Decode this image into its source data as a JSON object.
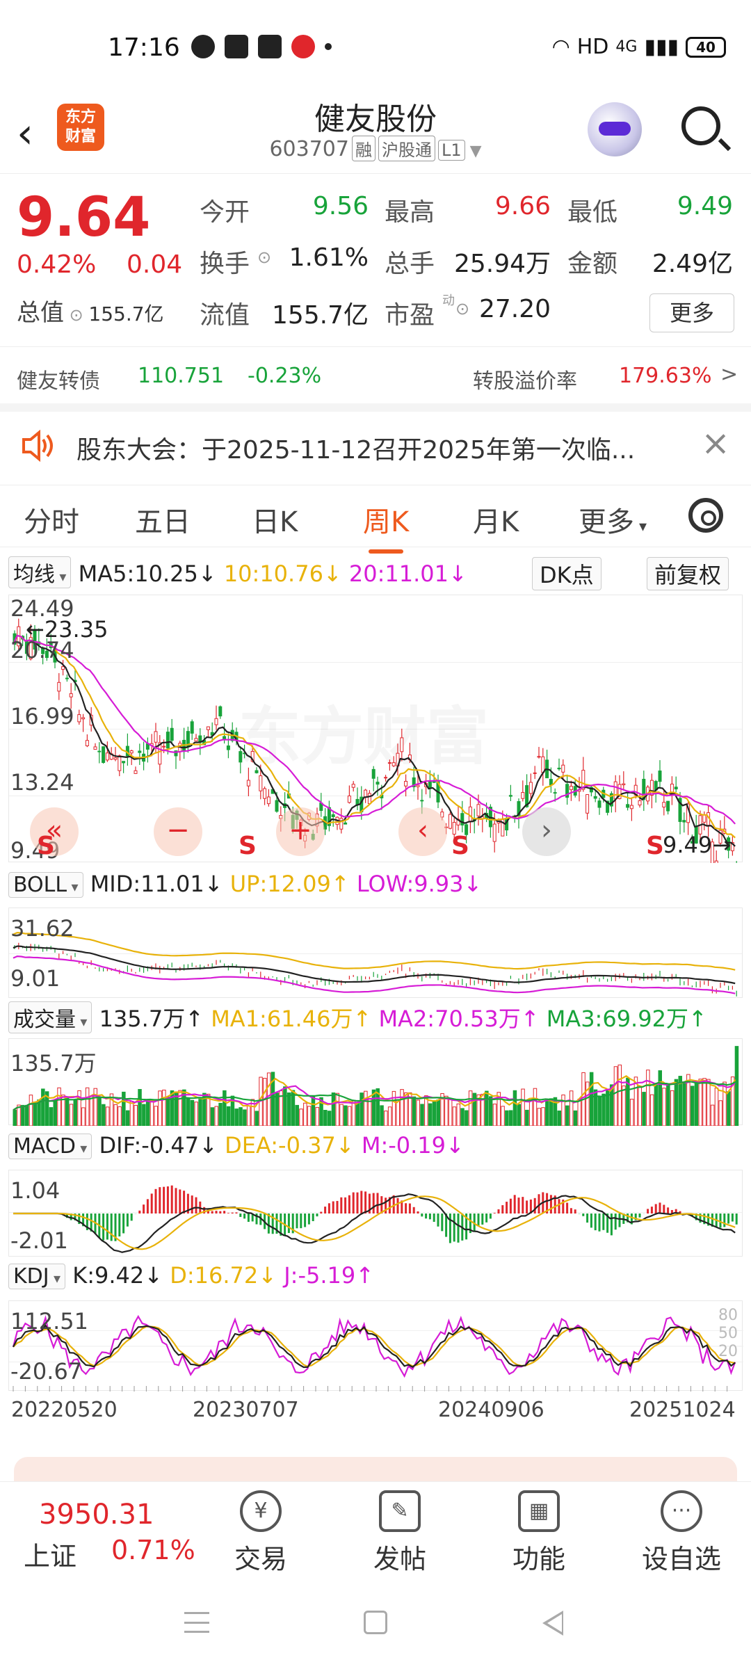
{
  "status": {
    "time": "17:16",
    "network": "HD",
    "signal": "4G",
    "battery": "40"
  },
  "header": {
    "title": "健友股份",
    "code": "603707",
    "tags": [
      "融",
      "沪股通",
      "L1"
    ],
    "logo_text": [
      "东方",
      "财富"
    ]
  },
  "quote": {
    "price": "9.64",
    "change_pct": "0.42%",
    "change": "0.04",
    "total_mv_label": "总值",
    "total_mv": "155.7亿",
    "fields": [
      {
        "label": "今开",
        "value": "9.56",
        "color": "green"
      },
      {
        "label": "最高",
        "value": "9.66",
        "color": "red"
      },
      {
        "label": "最低",
        "value": "9.49",
        "color": "green"
      },
      {
        "label": "换手",
        "value": "1.61%",
        "color": "dark"
      },
      {
        "label": "总手",
        "value": "25.94万",
        "color": "dark"
      },
      {
        "label": "金额",
        "value": "2.49亿",
        "color": "dark"
      },
      {
        "label": "流值",
        "value": "155.7亿",
        "color": "dark"
      },
      {
        "label": "市盈",
        "value": "27.20",
        "color": "dark"
      }
    ],
    "more_btn": "更多",
    "bond": {
      "name": "健友转债",
      "price": "110.751",
      "pct": "-0.23%",
      "premium_label": "转股溢价率",
      "premium": "179.63%"
    }
  },
  "notice": {
    "text": "股东大会：于2025-11-12召开2025年第一次临..."
  },
  "tabs": [
    {
      "label": "分时"
    },
    {
      "label": "五日"
    },
    {
      "label": "日K"
    },
    {
      "label": "周K"
    },
    {
      "label": "月K"
    },
    {
      "label": "更多"
    }
  ],
  "active_tab": "周K",
  "ma_row": {
    "selector": "均线",
    "ma5": "MA5:10.25↓",
    "ma10": "10:10.76↓",
    "ma20": "20:11.01↓",
    "dk": "DK点",
    "adjust": "前复权"
  },
  "kline_labels": {
    "max": "24.49",
    "mark_high": "←23.35",
    "l2": "20.74",
    "l3": "16.99",
    "l4": "13.24",
    "min": "9.49",
    "mark_low": "9.49→"
  },
  "boll_row": {
    "selector": "BOLL",
    "mid": "MID:11.01↓",
    "up": "UP:12.09↑",
    "low": "LOW:9.93↓"
  },
  "boll_labels": {
    "top": "31.62",
    "bottom": "9.01"
  },
  "vol_row": {
    "selector": "成交量",
    "vol": "135.7万↑",
    "ma1": "MA1:61.46万↑",
    "ma2": "MA2:70.53万↑",
    "ma3": "MA3:69.92万↑"
  },
  "vol_labels": {
    "top": "135.7万"
  },
  "macd_row": {
    "selector": "MACD",
    "dif": "DIF:-0.47↓",
    "dea": "DEA:-0.37↓",
    "m": "M:-0.19↓"
  },
  "macd_labels": {
    "top": "1.04",
    "bottom": "-2.01"
  },
  "kdj_row": {
    "selector": "KDJ",
    "k": "K:9.42↓",
    "d": "D:16.72↓",
    "j": "J:-5.19↑"
  },
  "kdj_labels": {
    "top": "112.51",
    "bottom": "-20.67",
    "l80": "80",
    "l50": "50",
    "l20": "20"
  },
  "dates": [
    "20220520",
    "20230707",
    "20240906",
    "20251024"
  ],
  "bottom": {
    "index_value": "3950.31",
    "index_name": "上证",
    "index_pct": "0.71%",
    "items": [
      {
        "label": "交易"
      },
      {
        "label": "发帖"
      },
      {
        "label": "功能"
      },
      {
        "label": "设自选"
      }
    ]
  },
  "colors": {
    "up": "#e0262c",
    "down": "#18a33a",
    "accent": "#ee5a1e",
    "ma5": "#222222",
    "ma10": "#e8b20a",
    "ma20": "#d61cd6"
  }
}
